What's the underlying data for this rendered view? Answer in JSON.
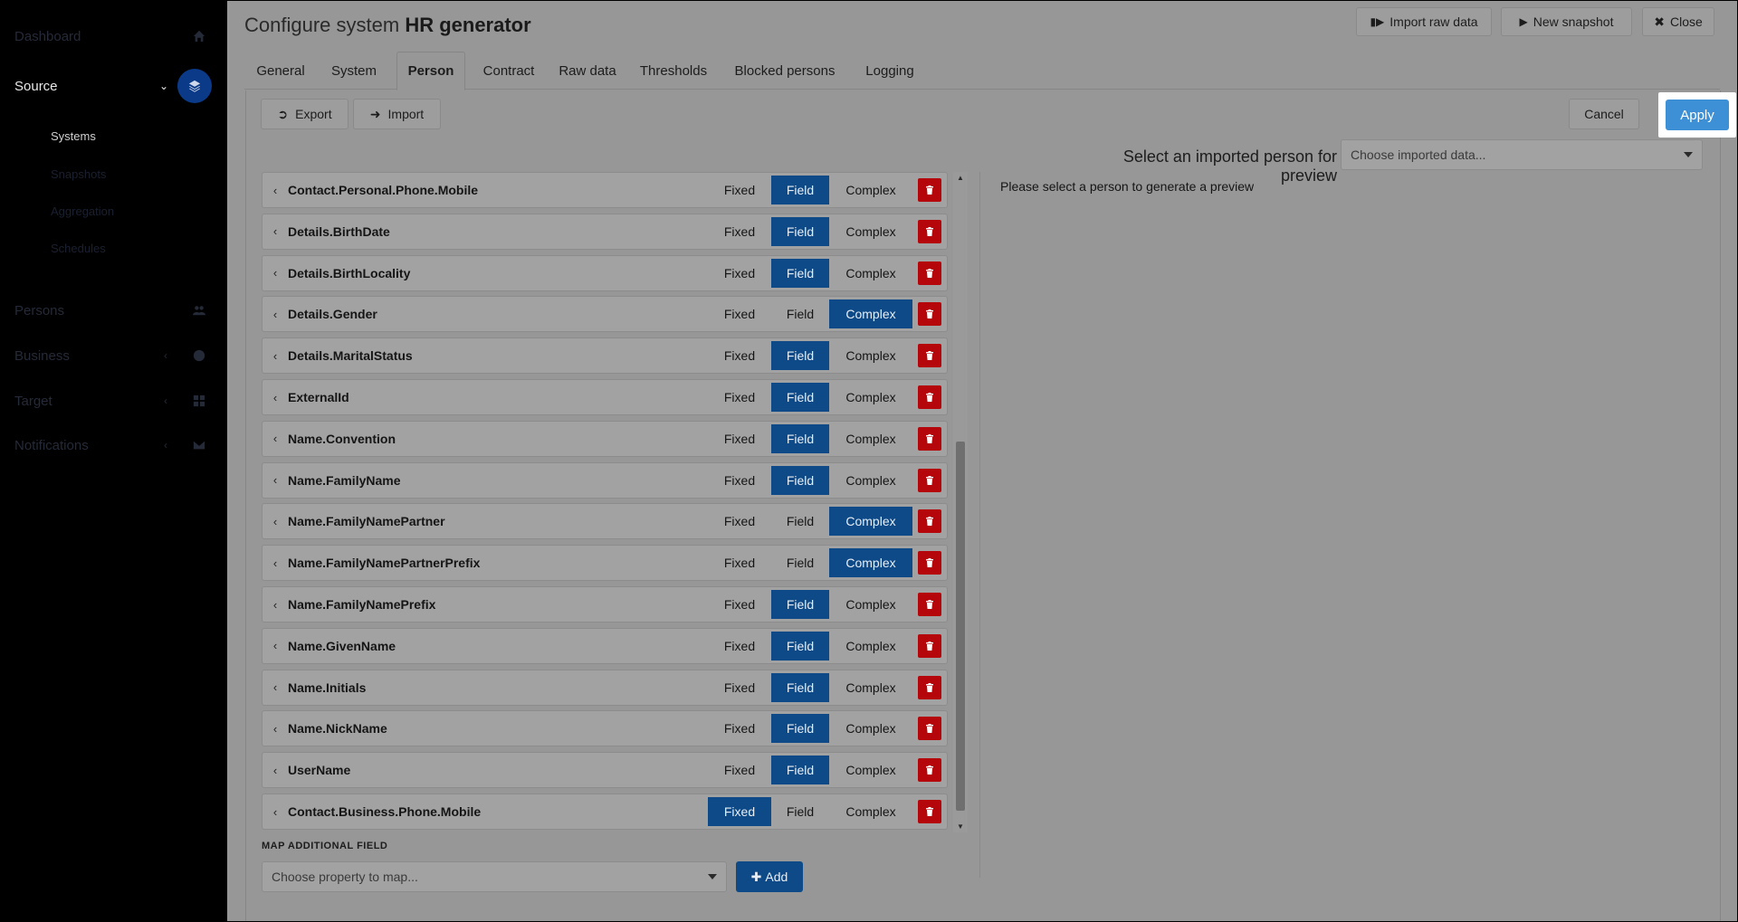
{
  "sidebar": {
    "items": [
      {
        "label": "Dashboard",
        "icon": "home-icon"
      },
      {
        "label": "Source",
        "icon": "layers-icon"
      },
      {
        "label": "Persons",
        "icon": "users-icon"
      },
      {
        "label": "Business",
        "icon": "palette-icon"
      },
      {
        "label": "Target",
        "icon": "grid-icon"
      },
      {
        "label": "Notifications",
        "icon": "envelope-icon"
      }
    ],
    "source_subitems": [
      "Systems",
      "Snapshots",
      "Aggregation",
      "Schedules"
    ]
  },
  "header": {
    "title_prefix": "Configure system",
    "title_bold": "HR generator",
    "buttons": {
      "import_raw": "Import raw data",
      "new_snapshot": "New snapshot",
      "close": "Close"
    }
  },
  "tabs": [
    "General",
    "System",
    "Person",
    "Contract",
    "Raw data",
    "Thresholds",
    "Blocked persons",
    "Logging"
  ],
  "active_tab": "Person",
  "toolbar": {
    "export": "Export",
    "import": "Import",
    "cancel": "Cancel",
    "apply": "Apply"
  },
  "segment_labels": {
    "fixed": "Fixed",
    "field": "Field",
    "complex": "Complex"
  },
  "mappings": [
    {
      "name": "Contact.Personal.Phone.Mobile",
      "mode": "Field"
    },
    {
      "name": "Details.BirthDate",
      "mode": "Field"
    },
    {
      "name": "Details.BirthLocality",
      "mode": "Field"
    },
    {
      "name": "Details.Gender",
      "mode": "Complex"
    },
    {
      "name": "Details.MaritalStatus",
      "mode": "Field"
    },
    {
      "name": "ExternalId",
      "mode": "Field"
    },
    {
      "name": "Name.Convention",
      "mode": "Field"
    },
    {
      "name": "Name.FamilyName",
      "mode": "Field"
    },
    {
      "name": "Name.FamilyNamePartner",
      "mode": "Complex"
    },
    {
      "name": "Name.FamilyNamePartnerPrefix",
      "mode": "Complex"
    },
    {
      "name": "Name.FamilyNamePrefix",
      "mode": "Field"
    },
    {
      "name": "Name.GivenName",
      "mode": "Field"
    },
    {
      "name": "Name.Initials",
      "mode": "Field"
    },
    {
      "name": "Name.NickName",
      "mode": "Field"
    },
    {
      "name": "UserName",
      "mode": "Field"
    },
    {
      "name": "Contact.Business.Phone.Mobile",
      "mode": "Fixed"
    }
  ],
  "map_additional": {
    "label": "MAP ADDITIONAL FIELD",
    "placeholder": "Choose property to map...",
    "add": "Add"
  },
  "preview": {
    "label": "Select an imported person for preview",
    "placeholder": "Choose imported data...",
    "message": "Please select a person to generate a preview"
  },
  "colors": {
    "active_segment": "#0d4a87",
    "apply": "#3d8fd6",
    "delete": "#b5070b",
    "source_circle": "#0b3a88"
  }
}
